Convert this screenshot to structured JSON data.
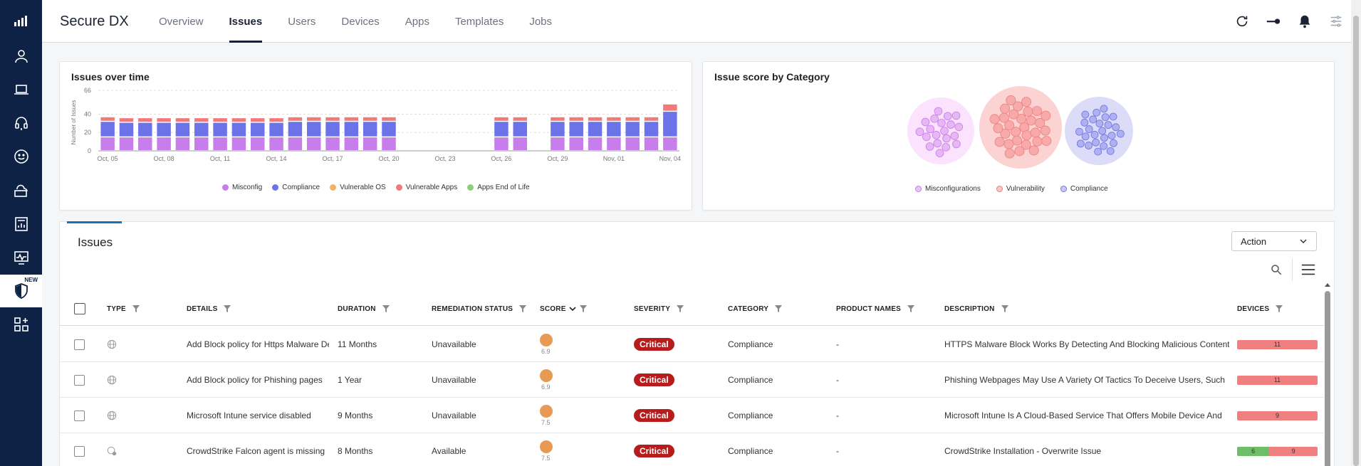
{
  "app": {
    "title": "Secure DX"
  },
  "nav": {
    "tabs": [
      {
        "label": "Overview"
      },
      {
        "label": "Issues"
      },
      {
        "label": "Users"
      },
      {
        "label": "Devices"
      },
      {
        "label": "Apps"
      },
      {
        "label": "Templates"
      },
      {
        "label": "Jobs"
      }
    ],
    "active": "Issues"
  },
  "rail": {
    "new_badge": "NEW",
    "items": [
      "analytics-icon",
      "user-icon",
      "laptop-icon",
      "headset-icon",
      "smile-icon",
      "cloud-folder-icon",
      "report-icon",
      "monitor-pulse-icon",
      "shield-icon",
      "apps-grid-icon"
    ]
  },
  "colors": {
    "misconfig": "#c77dea",
    "compliance": "#6c72e8",
    "vuln_os": "#f3b26b",
    "vuln_apps": "#f07a7a",
    "eol": "#8fcf7a",
    "critical": "#b71c1c",
    "accent": "#1f6fb5"
  },
  "issues_over_time": {
    "title": "Issues over time",
    "chart_data": {
      "type": "bar",
      "ylabel": "Number of Issues",
      "ylim": [
        0,
        66
      ],
      "yticks": [
        0,
        20,
        40,
        66
      ],
      "x_tick_labels": [
        "Oct, 05",
        "Oct, 08",
        "Oct, 11",
        "Oct, 14",
        "Oct, 17",
        "Oct, 20",
        "Oct, 23",
        "Oct, 26",
        "Oct, 29",
        "Nov, 01",
        "Nov, 04"
      ],
      "categories": [
        "Oct 05",
        "Oct 06",
        "Oct 07",
        "Oct 08",
        "Oct 09",
        "Oct 10",
        "Oct 11",
        "Oct 12",
        "Oct 13",
        "Oct 14",
        "Oct 15",
        "Oct 16",
        "Oct 17",
        "Oct 18",
        "Oct 19",
        "Oct 20",
        "Oct 21",
        "Oct 22",
        "Oct 23",
        "Oct 24",
        "Oct 25",
        "Oct 26",
        "Oct 27",
        "Oct 28",
        "Oct 29",
        "Oct 30",
        "Oct 31",
        "Nov 01",
        "Nov 02",
        "Nov 03",
        "Nov 04"
      ],
      "series": [
        {
          "name": "Misconfig",
          "values": [
            15,
            15,
            15,
            15,
            15,
            15,
            15,
            15,
            15,
            15,
            15,
            15,
            15,
            15,
            15,
            15,
            0,
            0,
            0,
            0,
            0,
            15,
            15,
            0,
            15,
            15,
            15,
            15,
            15,
            15,
            15
          ]
        },
        {
          "name": "Compliance",
          "values": [
            17,
            16,
            16,
            16,
            16,
            16,
            16,
            16,
            16,
            16,
            17,
            17,
            17,
            17,
            17,
            17,
            0,
            0,
            0,
            0,
            0,
            17,
            17,
            0,
            17,
            17,
            17,
            17,
            17,
            17,
            28
          ]
        },
        {
          "name": "Vulnerable OS",
          "values": [
            0,
            0,
            0,
            0,
            0,
            0,
            0,
            0,
            0,
            0,
            0,
            0,
            0,
            0,
            0,
            0,
            0,
            0,
            0,
            0,
            0,
            0,
            0,
            0,
            0,
            0,
            0,
            0,
            0,
            0,
            0
          ]
        },
        {
          "name": "Vulnerable Apps",
          "values": [
            5,
            5,
            5,
            5,
            5,
            5,
            5,
            5,
            5,
            5,
            5,
            5,
            5,
            5,
            5,
            5,
            0,
            0,
            0,
            0,
            0,
            5,
            5,
            0,
            5,
            5,
            5,
            5,
            5,
            5,
            8
          ]
        },
        {
          "name": "Apps End of Life",
          "values": [
            0,
            0,
            0,
            0,
            0,
            0,
            0,
            0,
            0,
            0,
            0,
            0,
            0,
            0,
            0,
            0,
            0,
            0,
            0,
            0,
            0,
            0,
            0,
            0,
            0,
            0,
            0,
            0,
            0,
            0,
            0
          ]
        }
      ],
      "legend_position": "bottom",
      "grid": true
    }
  },
  "score_by_category": {
    "title": "Issue score by Category",
    "chart_data": {
      "type": "bubble",
      "series": [
        {
          "name": "Misconfigurations",
          "bubbles": 20
        },
        {
          "name": "Vulnerability",
          "bubbles": 30
        },
        {
          "name": "Compliance",
          "bubbles": 25
        }
      ],
      "legend_position": "bottom"
    }
  },
  "issues": {
    "title": "Issues",
    "action_label": "Action",
    "columns": {
      "type": "TYPE",
      "details": "DETAILS",
      "duration": "DURATION",
      "remediation": "REMEDIATION STATUS",
      "score": "SCORE",
      "severity": "SEVERITY",
      "category": "CATEGORY",
      "product": "PRODUCT NAMES",
      "description": "DESCRIPTION",
      "devices": "DEVICES"
    },
    "rows": [
      {
        "type_icon": "globe-icon",
        "details": "Add Block policy for Https Malware Detection",
        "duration": "11 Months",
        "remediation": "Unavailable",
        "score": "6.9",
        "severity": "Critical",
        "category": "Compliance",
        "product": "-",
        "description": "HTTPS Malware Block Works By Detecting And Blocking Malicious Content",
        "devices_red": "11",
        "devices_green": ""
      },
      {
        "type_icon": "globe-icon",
        "details": "Add Block policy for Phishing pages",
        "duration": "1 Year",
        "remediation": "Unavailable",
        "score": "6.9",
        "severity": "Critical",
        "category": "Compliance",
        "product": "-",
        "description": "Phishing Webpages May Use A Variety Of Tactics To Deceive Users, Such",
        "devices_red": "11",
        "devices_green": ""
      },
      {
        "type_icon": "globe-icon",
        "details": "Microsoft Intune service disabled",
        "duration": "9 Months",
        "remediation": "Unavailable",
        "score": "7.5",
        "severity": "Critical",
        "category": "Compliance",
        "product": "-",
        "description": "Microsoft Intune Is A Cloud-Based Service That Offers Mobile Device And",
        "devices_red": "9",
        "devices_green": ""
      },
      {
        "type_icon": "device-user-icon",
        "details": "CrowdStrike Falcon agent is missing",
        "duration": "8 Months",
        "remediation": "Available",
        "score": "7.5",
        "severity": "Critical",
        "category": "Compliance",
        "product": "-",
        "description": "CrowdStrike Installation - Overwrite Issue",
        "devices_red": "9",
        "devices_green": "6"
      }
    ]
  }
}
